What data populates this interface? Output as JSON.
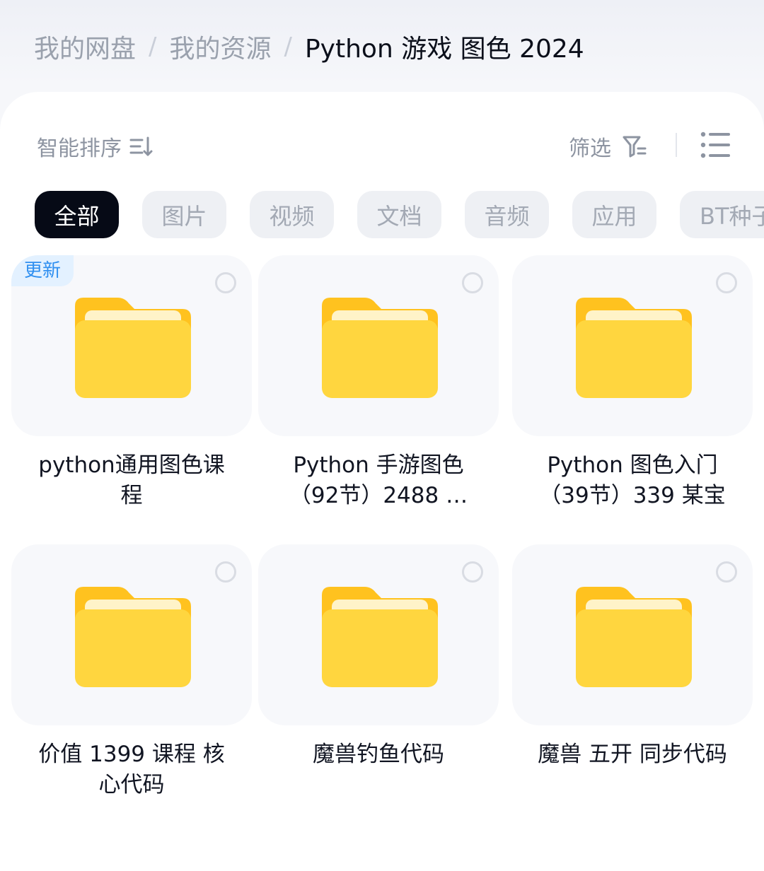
{
  "breadcrumb": {
    "items": [
      "我的网盘",
      "我的资源",
      "Python 游戏 图色 2024"
    ],
    "separator": "/"
  },
  "toolbar": {
    "sort_label": "智能排序",
    "filter_label": "筛选"
  },
  "chips": [
    {
      "label": "全部",
      "active": true
    },
    {
      "label": "图片",
      "active": false
    },
    {
      "label": "视频",
      "active": false
    },
    {
      "label": "文档",
      "active": false
    },
    {
      "label": "音频",
      "active": false
    },
    {
      "label": "应用",
      "active": false
    },
    {
      "label": "BT种子",
      "active": false
    }
  ],
  "files": [
    {
      "name": "python通用图色课程",
      "badge": "更新",
      "icon": "folder-icon"
    },
    {
      "name": "Python 手游图色（92节）2488 …",
      "badge": "",
      "icon": "folder-icon"
    },
    {
      "name": "Python 图色入门（39节）339 某宝",
      "badge": "",
      "icon": "folder-icon"
    },
    {
      "name": "价值 1399 课程 核心代码",
      "badge": "",
      "icon": "folder-icon"
    },
    {
      "name": "魔兽钓鱼代码",
      "badge": "",
      "icon": "folder-icon"
    },
    {
      "name": "魔兽 五开 同步代码",
      "badge": "",
      "icon": "folder-icon"
    }
  ],
  "colors": {
    "accent_dark": "#060a16",
    "badge_text": "#2f8ff0",
    "badge_bg": "#e3f1ff",
    "folder_yellow": "#ffd43b"
  }
}
